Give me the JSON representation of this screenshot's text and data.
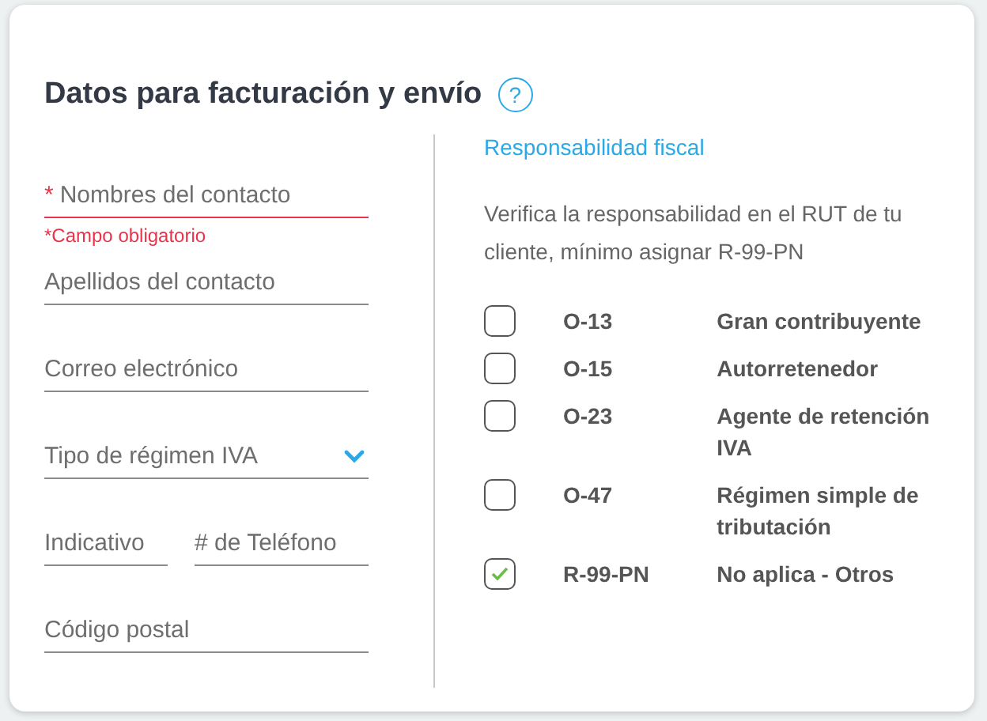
{
  "title": "Datos para facturación y envío",
  "help": "?",
  "fields": [
    {
      "kind": "text",
      "mark": "*",
      "placeholder": "Nombres del contacto",
      "error": "*Campo obligatorio"
    },
    {
      "kind": "text",
      "placeholder": "Apellidos del contacto"
    },
    {
      "kind": "text",
      "placeholder": "Correo electrónico"
    },
    {
      "kind": "select",
      "placeholder": "Tipo de régimen IVA"
    },
    {
      "kind": "pair",
      "parts": [
        {
          "placeholder": "Indicativo"
        },
        {
          "placeholder": "# de Teléfono"
        }
      ]
    },
    {
      "kind": "text",
      "placeholder": "Código postal"
    }
  ],
  "fiscal": {
    "link": "Responsabilidad fiscal",
    "description": "Verifica la responsabilidad en el RUT de tu cliente, mínimo asignar R-99-PN",
    "options": [
      {
        "code": "O-13",
        "label": "Gran contribuyente",
        "checked": false
      },
      {
        "code": "O-15",
        "label": "Autorretenedor",
        "checked": false
      },
      {
        "code": "O-23",
        "label": "Agente de retención IVA",
        "checked": false
      },
      {
        "code": "O-47",
        "label": "Régimen simple de tributación",
        "checked": false
      },
      {
        "code": "R-99-PN",
        "label": "No aplica - Otros",
        "checked": true
      }
    ]
  }
}
